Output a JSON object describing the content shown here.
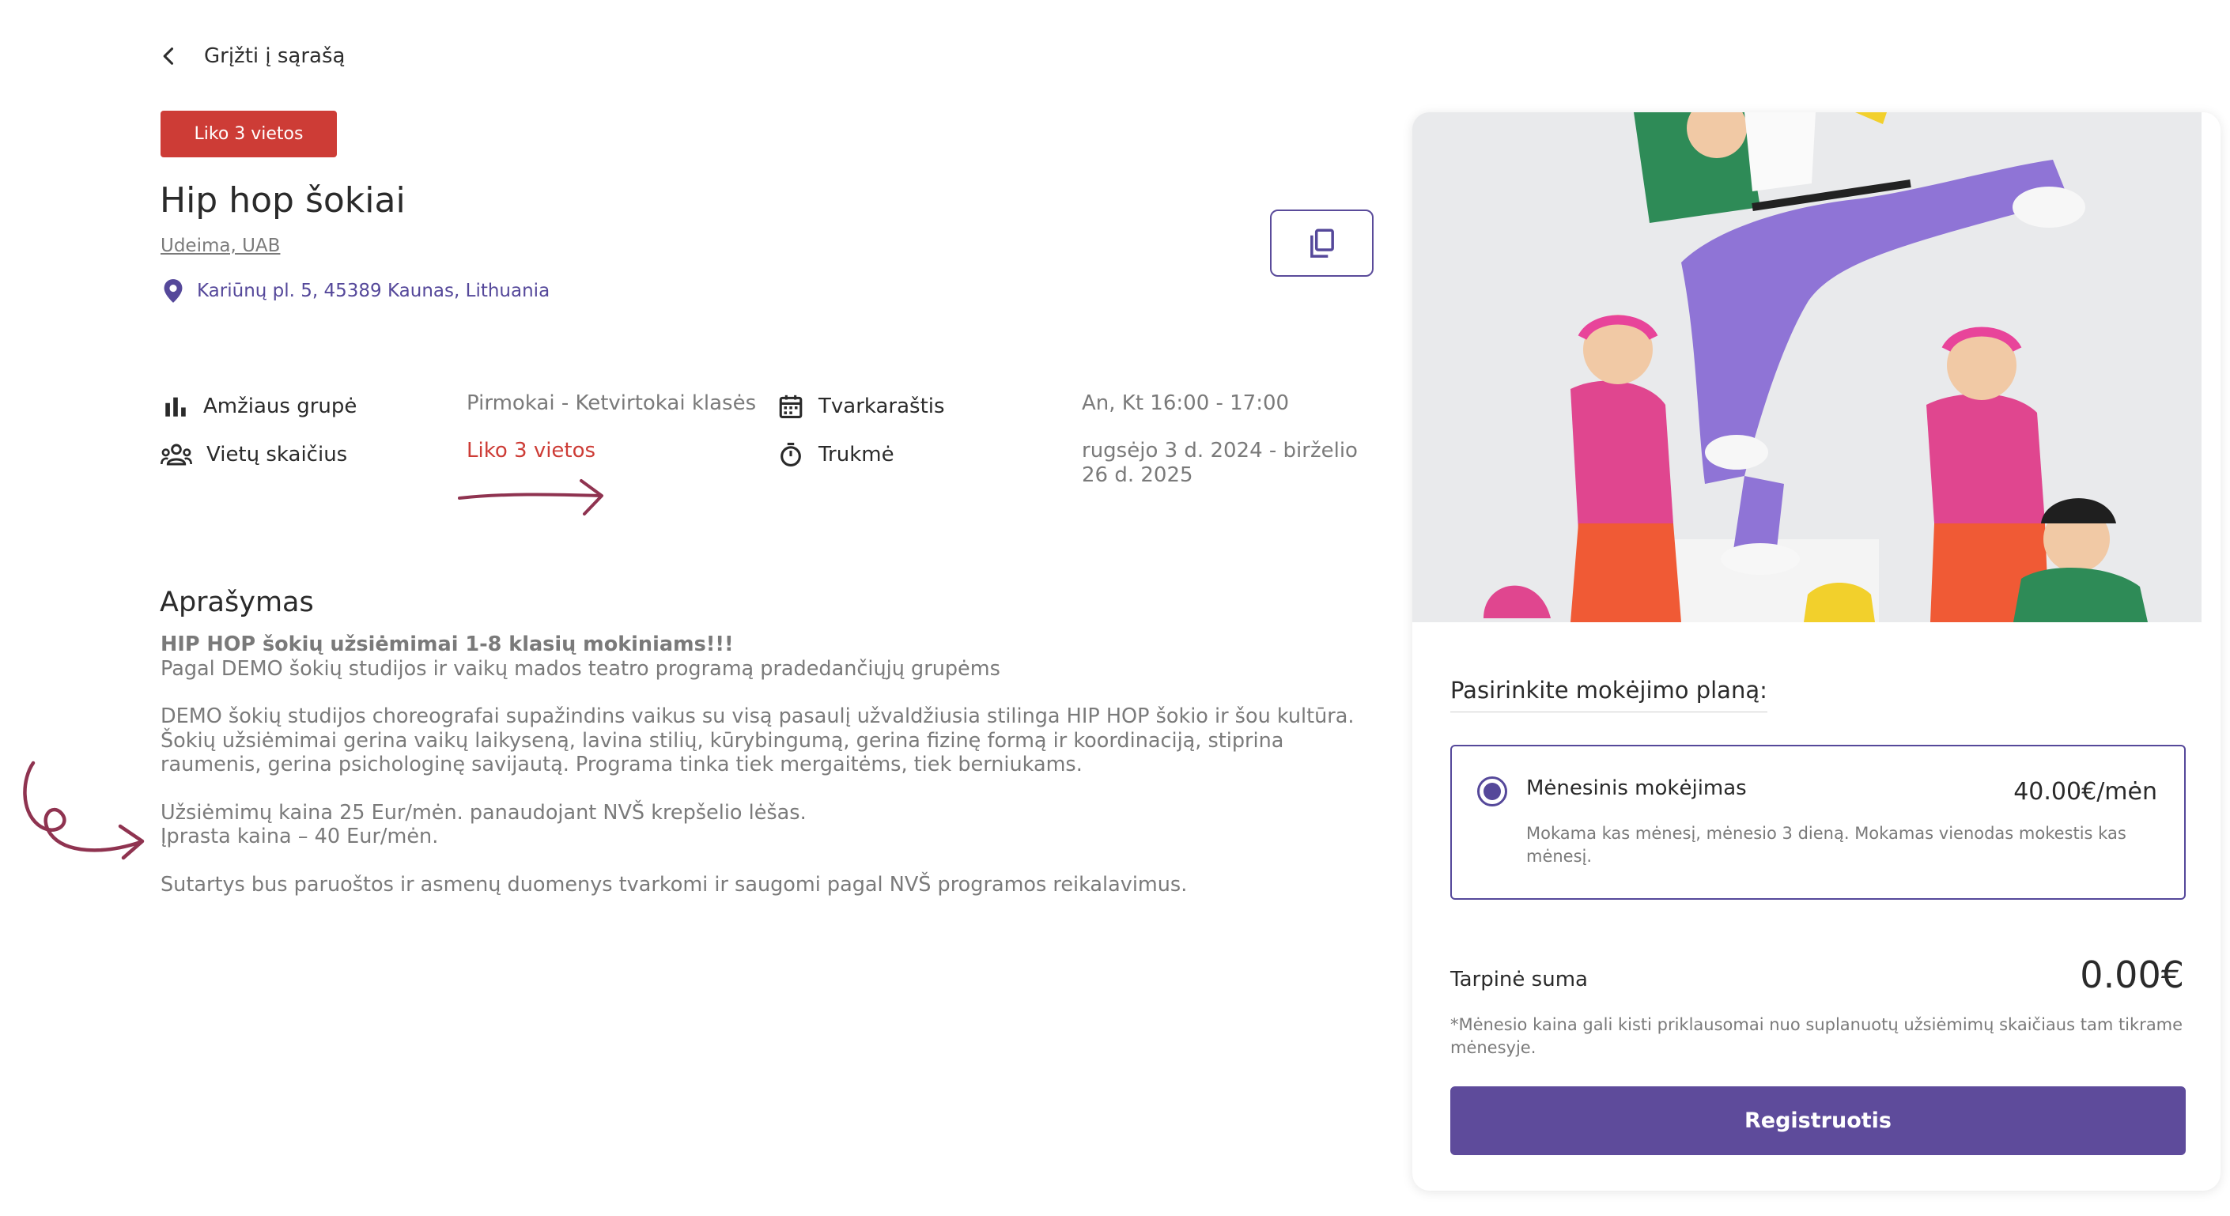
{
  "nav": {
    "back_label": "Grįžti į sąrašą"
  },
  "badge": {
    "label": "Liko 3 vietos"
  },
  "course": {
    "title": "Hip hop šokiai",
    "organizer": "Udeima, UAB",
    "address": "Kariūnų pl. 5, 45389 Kaunas, Lithuania"
  },
  "details": {
    "age_label": "Amžiaus grupė",
    "age_value": "Pirmokai - Ketvirtokai klasės",
    "seats_label": "Vietų skaičius",
    "seats_value": "Liko 3 vietos",
    "schedule_label": "Tvarkaraštis",
    "schedule_value": "An, Kt 16:00 - 17:00",
    "duration_label": "Trukmė",
    "duration_value_line1": "rugsėjo 3 d. 2024 - birželio",
    "duration_value_line2": "26 d. 2025"
  },
  "description": {
    "heading": "Aprašymas",
    "bold_line": "HIP HOP šokių užsiėmimai 1-8 klasių mokiniams!!!",
    "line2": "Pagal DEMO šokių studijos ir vaikų mados teatro programą pradedančiųjų grupėms",
    "para2": "DEMO šokių studijos choreografai supažindins vaikus su visą pasaulį užvaldžiusia stilinga HIP HOP šokio ir šou kultūra. Šokių užsiėmimai gerina vaikų laikyseną, lavina stilių, kūrybingumą, gerina fizinę formą ir koordinaciją, stiprina raumenis, gerina psichologinę savijautą. Programa tinka tiek mergaitėms, tiek berniukams.",
    "price_line1": "Užsiėmimų kaina 25 Eur/mėn. panaudojant NVŠ krepšelio lėšas.",
    "price_line2": "Įprasta kaina – 40 Eur/mėn.",
    "para4": "Sutartys bus paruoštos ir asmenų duomenys tvarkomi ir saugomi pagal NVŠ programos reikalavimus."
  },
  "payment": {
    "heading": "Pasirinkite mokėjimo planą:",
    "plan_name": "Mėnesinis mokėjimas",
    "plan_price": "40.00€/mėn",
    "plan_note": "Mokama kas mėnesį, mėnesio 3 dieną. Mokamas vienodas mokestis kas mėnesį.",
    "subtotal_label": "Tarpinė suma",
    "subtotal_value": "0.00€",
    "footnote": "*Mėnesio kaina gali kisti priklausomai nuo suplanuotų užsiėmimų skaičiaus tam tikrame mėnesyje.",
    "register_label": "Registruotis"
  },
  "colors": {
    "accent": "#5e4b9b",
    "badge_red": "#cd3c36",
    "annotation_arrow": "#8f3350"
  }
}
